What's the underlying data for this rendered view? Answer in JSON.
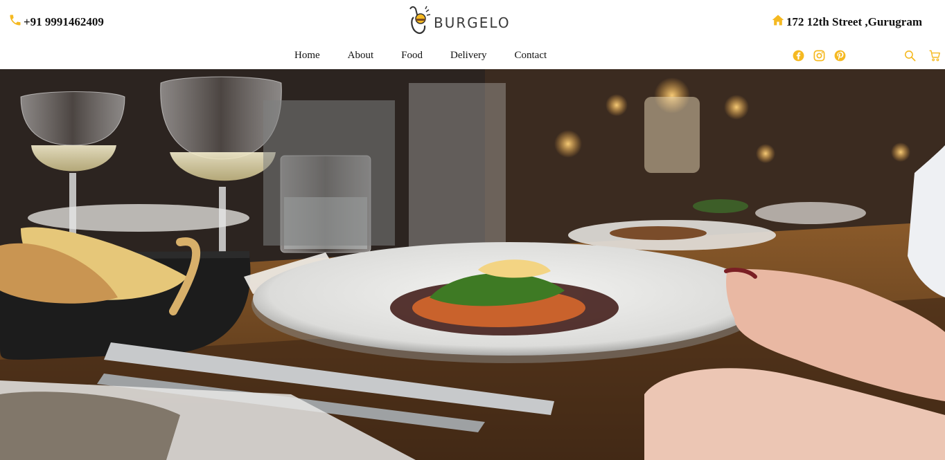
{
  "header": {
    "phone": "+91 9991462409",
    "address": "172 12th Street ,Gurugram",
    "logo_text": "BURGELO"
  },
  "nav": {
    "items": [
      "Home",
      "About",
      "Food",
      "Delivery",
      "Contact"
    ]
  },
  "social": [
    "facebook-icon",
    "instagram-icon",
    "pinterest-icon"
  ],
  "tools": [
    "search-icon",
    "cart-icon"
  ],
  "colors": {
    "accent": "#f5b921",
    "text": "#111111"
  }
}
